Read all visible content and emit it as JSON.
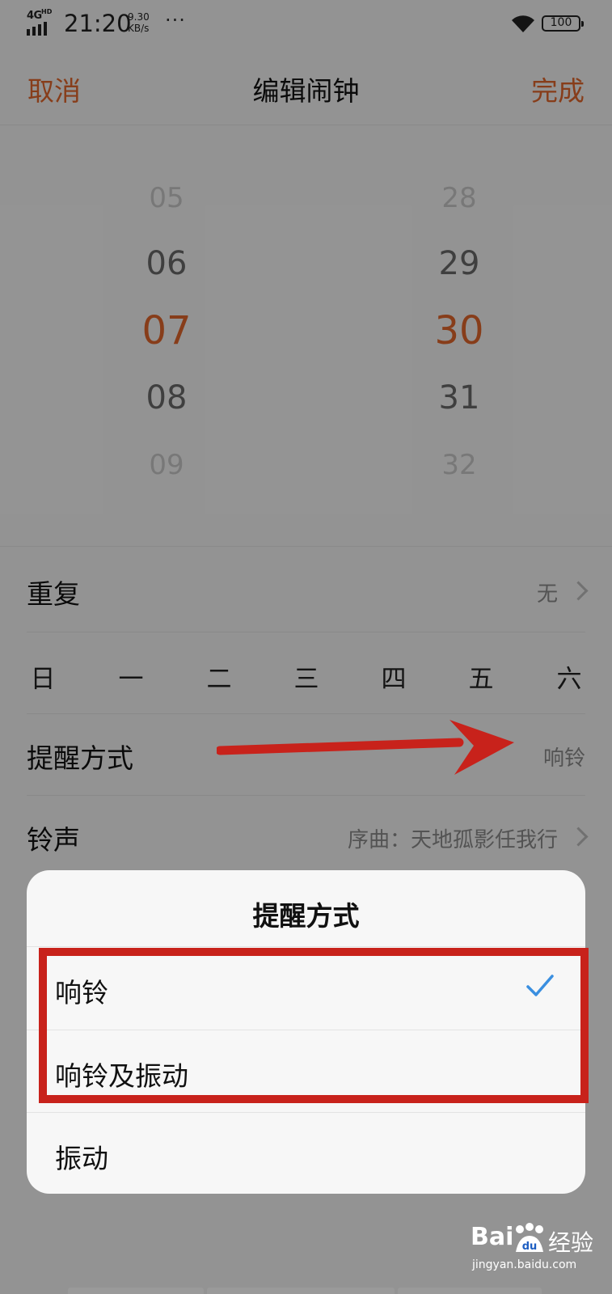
{
  "status_bar": {
    "network": "4G",
    "network_hd": "HD",
    "time": "21:20",
    "speed_value": "9.30",
    "speed_unit": "KB/s",
    "more": "···",
    "battery": "100",
    "wifi_icon": "wifi-icon"
  },
  "header": {
    "cancel": "取消",
    "title": "编辑闹钟",
    "done": "完成",
    "accent_color": "#e2672c"
  },
  "picker": {
    "hours": [
      "05",
      "06",
      "07",
      "08",
      "09"
    ],
    "minutes": [
      "28",
      "29",
      "30",
      "31",
      "32"
    ],
    "selected_hour": "07",
    "selected_minute": "30"
  },
  "settings": {
    "repeat": {
      "label": "重复",
      "value": "无"
    },
    "weekdays": [
      "日",
      "一",
      "二",
      "三",
      "四",
      "五",
      "六"
    ],
    "reminder": {
      "label": "提醒方式",
      "value": "响铃"
    },
    "ringtone": {
      "label": "铃声",
      "value": "序曲：天地孤影任我行"
    }
  },
  "sheet": {
    "title": "提醒方式",
    "options": [
      {
        "label": "响铃",
        "selected": true
      },
      {
        "label": "响铃及振动",
        "selected": false
      },
      {
        "label": "振动",
        "selected": false
      }
    ],
    "check_color": "#3a8fe0"
  },
  "annotation": {
    "color": "#c8221b"
  },
  "watermark": {
    "logo": "Bai",
    "paw": "du",
    "text": "经验",
    "url": "jingyan.baidu.com"
  }
}
